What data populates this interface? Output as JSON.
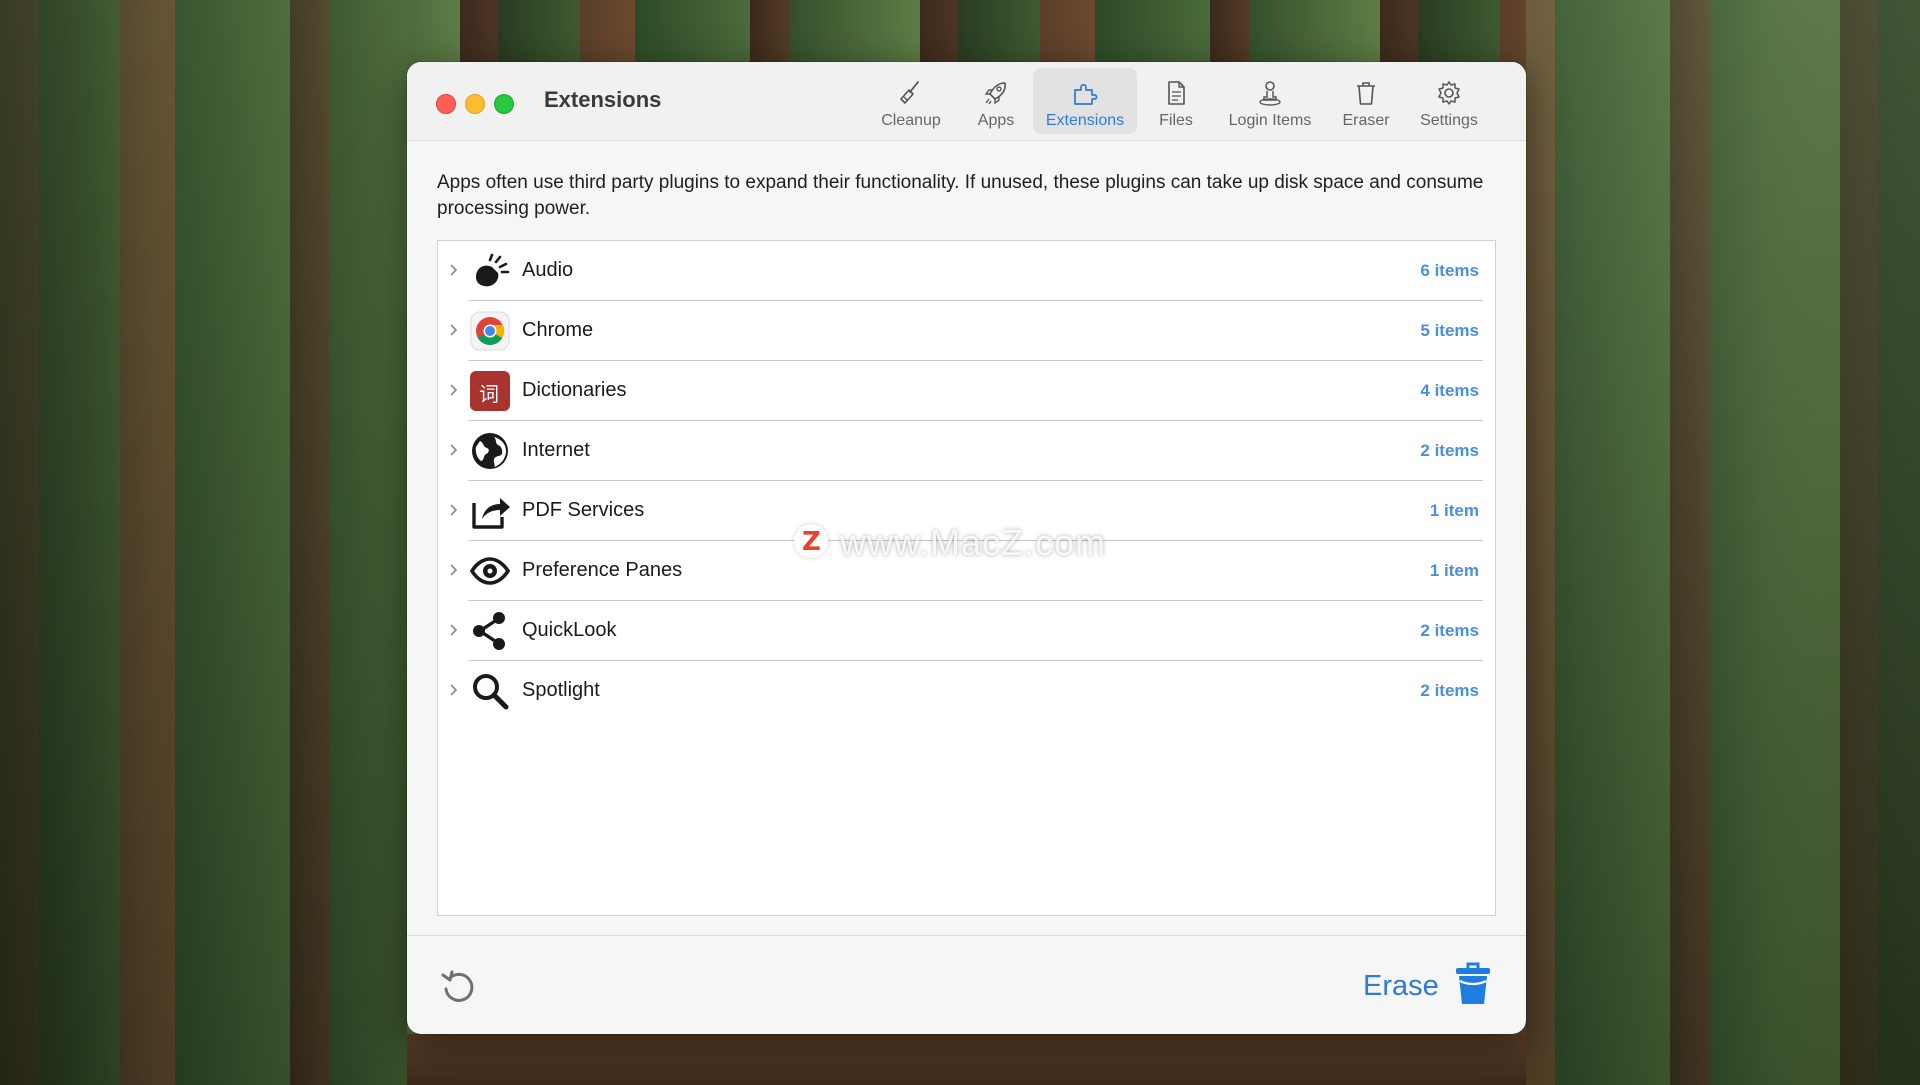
{
  "window": {
    "title": "Extensions"
  },
  "toolbar": {
    "items": [
      {
        "label": "Cleanup",
        "icon": "broom-icon"
      },
      {
        "label": "Apps",
        "icon": "rocket-icon"
      },
      {
        "label": "Extensions",
        "icon": "puzzle-icon",
        "active": true
      },
      {
        "label": "Files",
        "icon": "document-icon"
      },
      {
        "label": "Login Items",
        "icon": "user-login-icon"
      },
      {
        "label": "Eraser",
        "icon": "trash-icon"
      },
      {
        "label": "Settings",
        "icon": "gear-icon"
      }
    ]
  },
  "description": "Apps often use third party plugins to expand their functionality. If unused, these plugins can take up disk space and consume processing power.",
  "extensions": [
    {
      "label": "Audio",
      "count": "6 items",
      "icon": "audio-icon"
    },
    {
      "label": "Chrome",
      "count": "5 items",
      "icon": "chrome-icon"
    },
    {
      "label": "Dictionaries",
      "count": "4 items",
      "icon": "dictionary-icon"
    },
    {
      "label": "Internet",
      "count": "2 items",
      "icon": "globe-icon"
    },
    {
      "label": "PDF Services",
      "count": "1 item",
      "icon": "share-arrow-icon"
    },
    {
      "label": "Preference Panes",
      "count": "1 item",
      "icon": "preference-eye-icon"
    },
    {
      "label": "QuickLook",
      "count": "2 items",
      "icon": "share-nodes-icon"
    },
    {
      "label": "Spotlight",
      "count": "2 items",
      "icon": "magnifier-icon"
    }
  ],
  "dictionary_glyph": "词",
  "footer": {
    "erase_label": "Erase"
  },
  "watermark": {
    "logo": "Z",
    "text": "www.MacZ.com"
  },
  "colors": {
    "accent": "#2f7bd6",
    "count": "#4a90d9",
    "close": "#ff5f57",
    "minimize": "#febc2e",
    "maximize": "#28c840"
  }
}
